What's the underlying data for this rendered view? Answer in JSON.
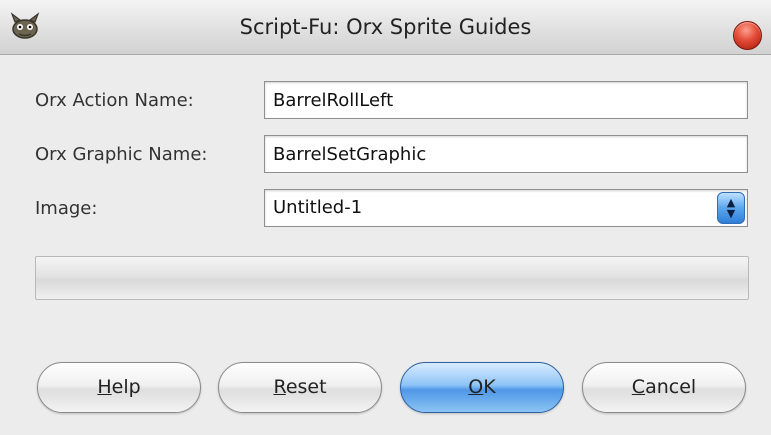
{
  "window": {
    "title": "Script-Fu: Orx Sprite Guides",
    "app_icon": "gimp-wilber-icon",
    "close_icon": "close-icon"
  },
  "form": {
    "action_label": "Orx Action Name:",
    "action_value": "BarrelRollLeft",
    "graphic_label": "Orx Graphic Name:",
    "graphic_value": "BarrelSetGraphic",
    "image_label": "Image:",
    "image_selected": "Untitled-1",
    "image_options": [
      "Untitled-1"
    ]
  },
  "progress": {
    "value": 0
  },
  "buttons": {
    "help": {
      "mnemonic": "H",
      "rest": "elp"
    },
    "reset": {
      "mnemonic": "R",
      "rest": "eset"
    },
    "ok": {
      "mnemonic": "O",
      "rest": "K"
    },
    "cancel": {
      "mnemonic": "C",
      "rest": "ancel"
    }
  },
  "colors": {
    "accent": "#4f97e6",
    "close": "#e24a35"
  }
}
